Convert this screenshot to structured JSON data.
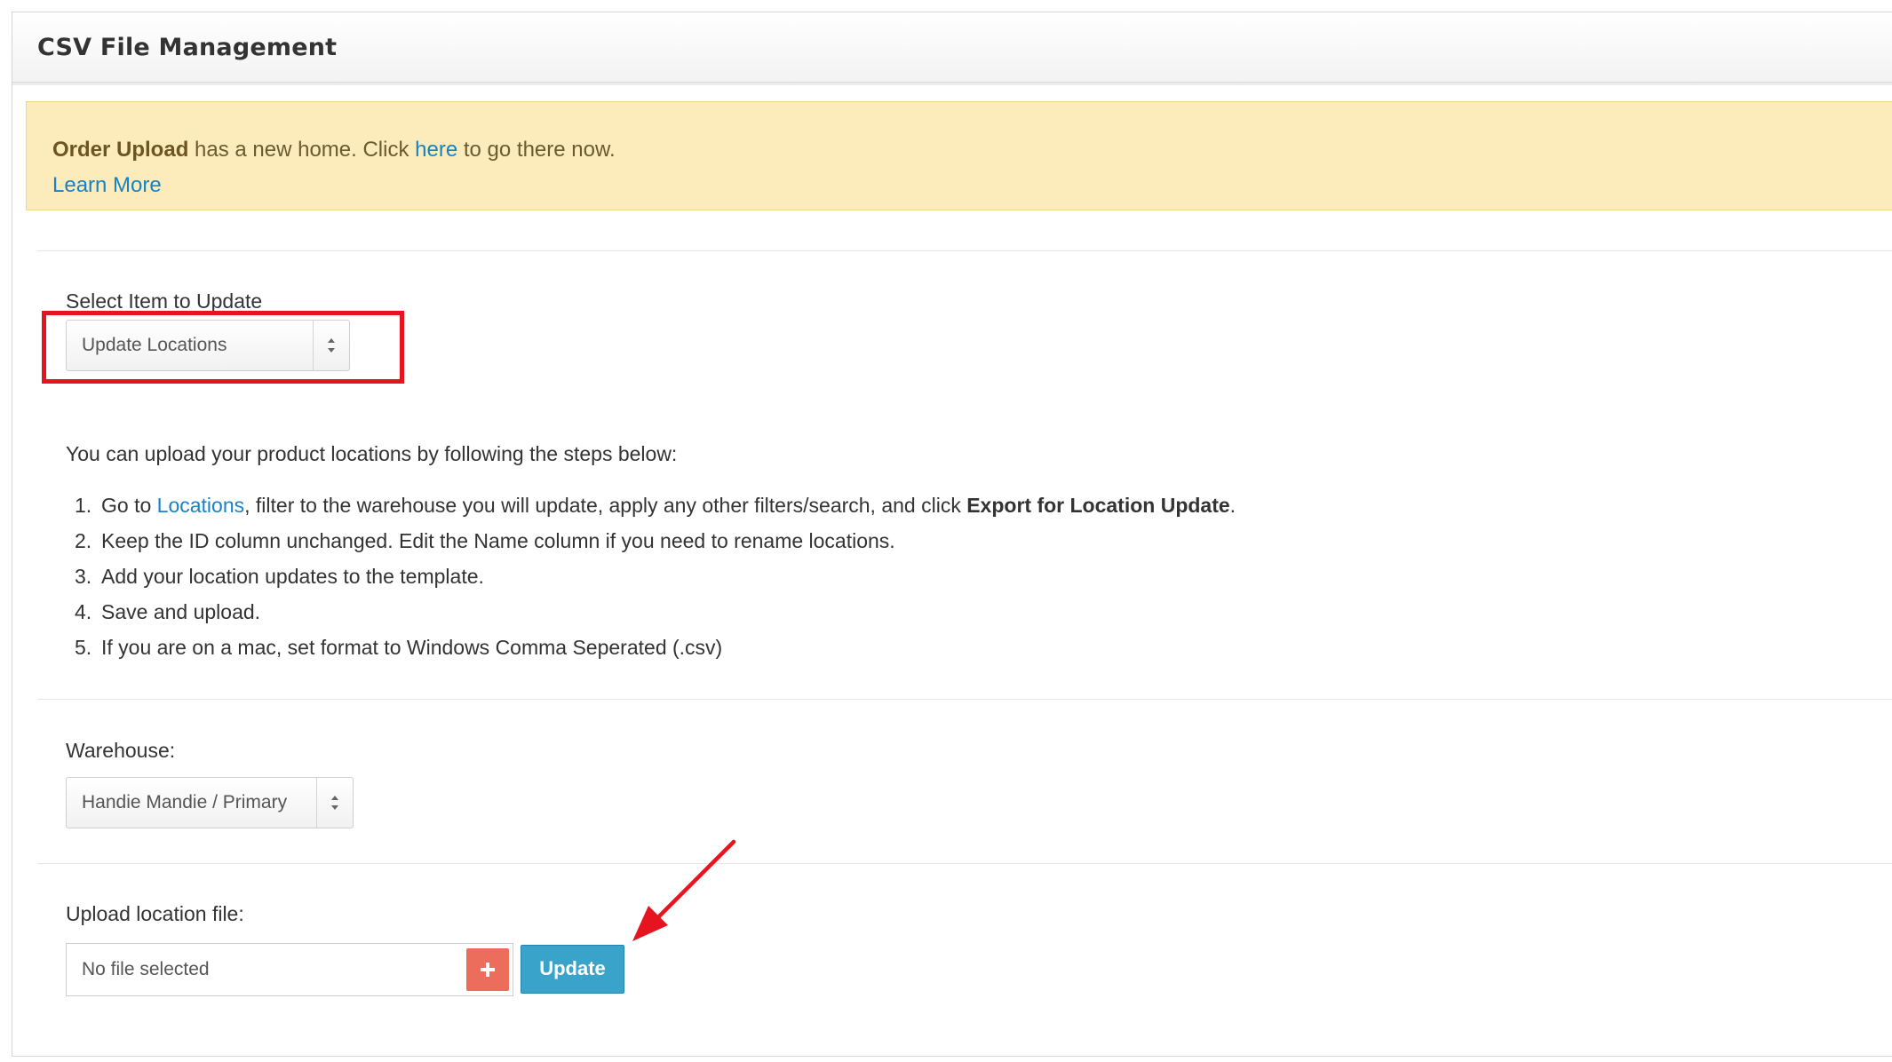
{
  "header": {
    "title": "CSV File Management"
  },
  "alert": {
    "strong_text": "Order Upload",
    "text_before_link": " has a new home. Click ",
    "link_text": "here",
    "text_after_link": " to go there now.",
    "learn_more": "Learn More"
  },
  "select_item": {
    "label": "Select Item to Update",
    "value": "Update Locations"
  },
  "instructions": {
    "intro": "You can upload your product locations by following the steps below:",
    "step1_prefix": "Go to ",
    "step1_link": "Locations",
    "step1_middle": ", filter to the warehouse you will update, apply any other filters/search, and click ",
    "step1_bold": "Export for Location Update",
    "step1_suffix": ".",
    "step2": "Keep the ID column unchanged. Edit the Name column if you need to rename locations.",
    "step3": "Add your location updates to the template.",
    "step4": "Save and upload.",
    "step5": "If you are on a mac, set format to Windows Comma Seperated (.csv)",
    "numbers": [
      "1.",
      "2.",
      "3.",
      "4.",
      "5."
    ]
  },
  "warehouse": {
    "label": "Warehouse:",
    "value": "Handie Mandie / Primary"
  },
  "upload": {
    "label": "Upload location file:",
    "file_text": "No file selected",
    "update_label": "Update"
  },
  "colors": {
    "highlight": "#e6141e",
    "link": "#1a82c4",
    "alert_bg": "#fcecbb",
    "update_button": "#3aa3c9",
    "plus_button": "#ec6d5b"
  }
}
